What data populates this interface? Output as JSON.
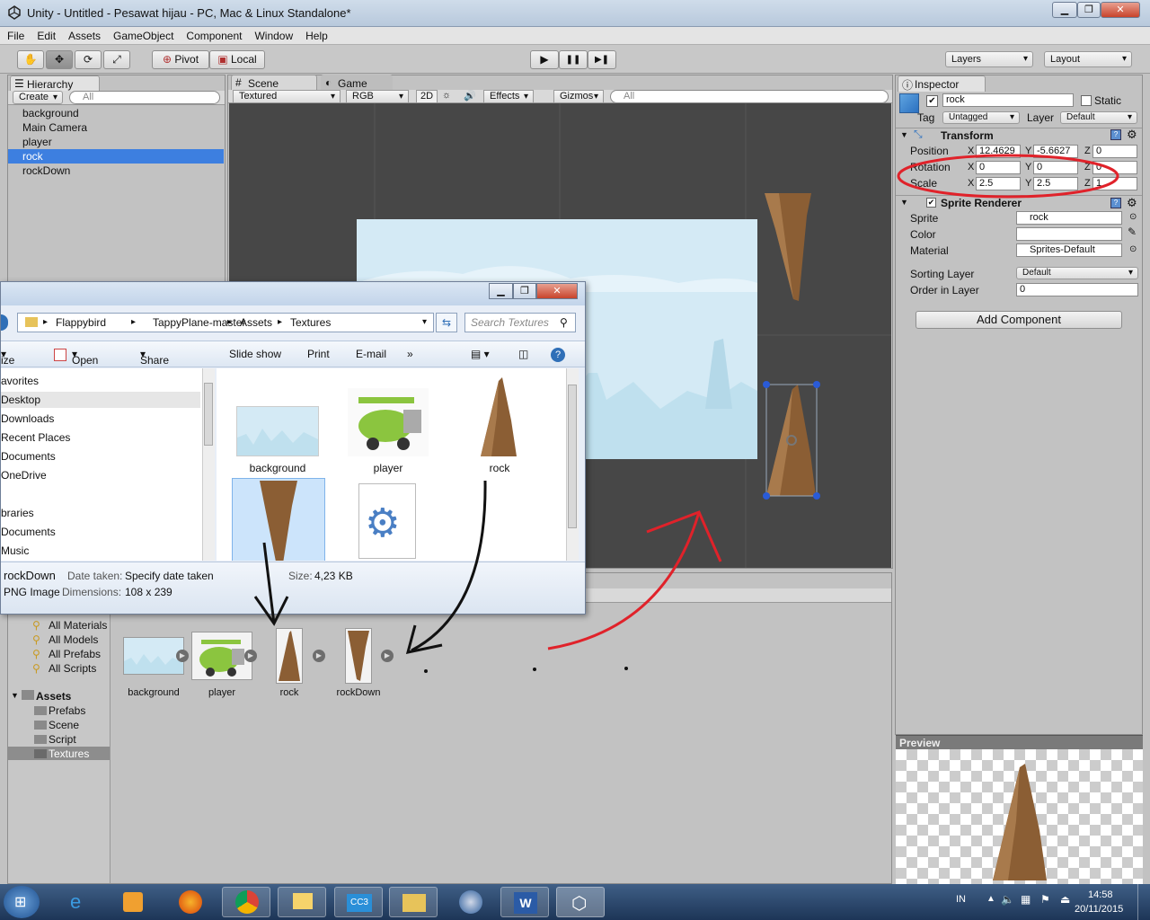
{
  "window": {
    "title": "Unity - Untitled - Pesawat hijau - PC, Mac & Linux Standalone*",
    "min": "▁",
    "max": "❐",
    "close": "✕"
  },
  "menu": [
    "File",
    "Edit",
    "Assets",
    "GameObject",
    "Component",
    "Window",
    "Help"
  ],
  "toolbar": {
    "pivot": "Pivot",
    "local": "Local",
    "layers": "Layers",
    "layout": "Layout",
    "play_icon": "▶",
    "pause_icon": "❚❚",
    "step_icon": "▶❚"
  },
  "hierarchy": {
    "tab": "Hierarchy",
    "create": "Create",
    "search_placeholder": "All",
    "items": [
      {
        "label": "background"
      },
      {
        "label": "Main Camera"
      },
      {
        "label": "player"
      },
      {
        "label": "rock",
        "selected": true
      },
      {
        "label": "rockDown"
      }
    ]
  },
  "scene": {
    "tab_scene": "Scene",
    "tab_game": "Game",
    "shading": "Textured",
    "rgb": "RGB",
    "mode2d": "2D",
    "effects": "Effects",
    "gizmos": "Gizmos",
    "search_placeholder": "All"
  },
  "inspector": {
    "tab": "Inspector",
    "name": "rock",
    "static": "Static",
    "tag_label": "Tag",
    "tag": "Untagged",
    "layer_label": "Layer",
    "layer": "Default",
    "transform": {
      "title": "Transform",
      "position_label": "Position",
      "rotation_label": "Rotation",
      "scale_label": "Scale",
      "axis_x": "X",
      "axis_y": "Y",
      "axis_z": "Z",
      "position": [
        "12.4629",
        "-5.6627",
        "0"
      ],
      "rotation": [
        "0",
        "0",
        "0"
      ],
      "scale": [
        "2.5",
        "2.5",
        "1"
      ]
    },
    "sprite_renderer": {
      "title": "Sprite Renderer",
      "sprite_label": "Sprite",
      "sprite": "rock",
      "color_label": "Color",
      "material_label": "Material",
      "material": "Sprites-Default",
      "sorting_layer_label": "Sorting Layer",
      "sorting_layer": "Default",
      "order_label": "Order in Layer",
      "order": "0"
    },
    "add_component": "Add Component",
    "preview": "Preview"
  },
  "explorer": {
    "breadcrumb": [
      "Flappybird",
      "TappyPlane-master",
      "Assets",
      "Textures"
    ],
    "search_placeholder": "Search Textures",
    "commands": {
      "organize": "ize",
      "open": "Open",
      "share": "Share with",
      "slideshow": "Slide show",
      "print": "Print",
      "email": "E-mail",
      "more": "»"
    },
    "nav": [
      "avorites",
      "Desktop",
      "Downloads",
      "Recent Places",
      "Documents",
      "OneDrive",
      "",
      "braries",
      "Documents",
      "Music"
    ],
    "files": [
      {
        "label": "background"
      },
      {
        "label": "player"
      },
      {
        "label": "rock"
      }
    ],
    "details": {
      "name": "rockDown",
      "type": "PNG Image",
      "date_label": "Date taken:",
      "date": "Specify date taken",
      "size_label": "Size:",
      "size": "4,23 KB",
      "dims_label": "Dimensions:",
      "dims": "108 x 239"
    }
  },
  "project": {
    "favorites": [
      "All Materials",
      "All Models",
      "All Prefabs",
      "All Scripts"
    ],
    "assets_label": "Assets",
    "folders": [
      "Prefabs",
      "Scene",
      "Script",
      "Textures"
    ],
    "assets": [
      {
        "label": "background"
      },
      {
        "label": "player"
      },
      {
        "label": "rock"
      },
      {
        "label": "rockDown"
      }
    ]
  },
  "taskbar": {
    "lang": "IN",
    "time": "14:58",
    "date": "20/11/2015"
  },
  "colors": {
    "selection": "#3d7fe0",
    "annotation_red": "#e0222a",
    "rock": "#8b5e34",
    "sky": "#d4eaf5"
  }
}
